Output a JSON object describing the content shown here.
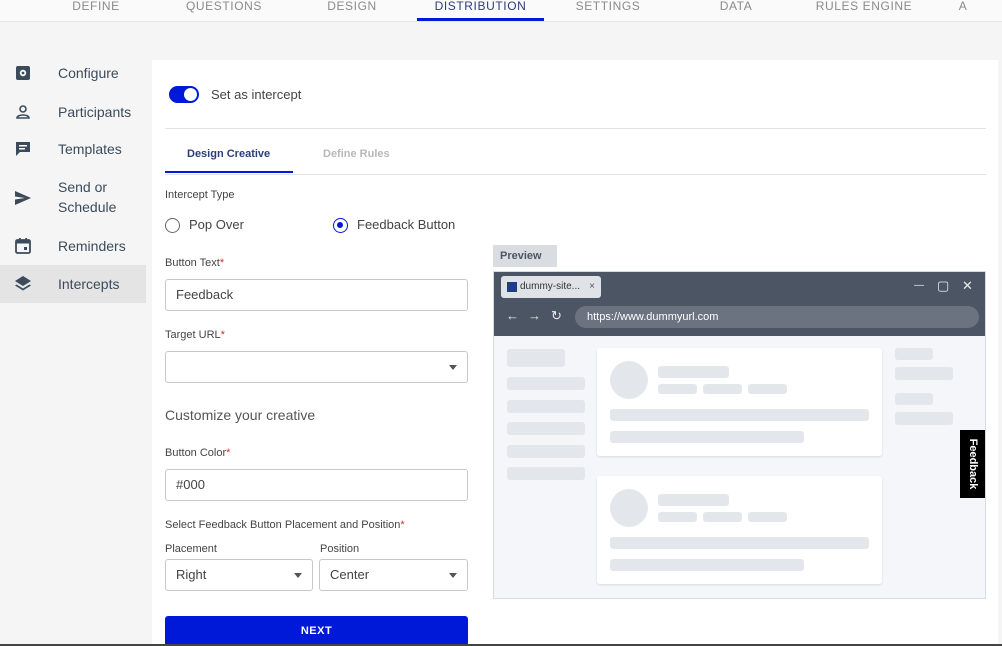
{
  "top_tabs": [
    {
      "label": "DEFINE"
    },
    {
      "label": "QUESTIONS"
    },
    {
      "label": "DESIGN"
    },
    {
      "label": "DISTRIBUTION"
    },
    {
      "label": "SETTINGS"
    },
    {
      "label": "DATA"
    },
    {
      "label": "RULES ENGINE"
    },
    {
      "label": "A"
    }
  ],
  "sidebar": {
    "items": [
      {
        "label": "Configure",
        "icon": "gear-icon"
      },
      {
        "label": "Participants",
        "icon": "person-icon"
      },
      {
        "label": "Templates",
        "icon": "chat-icon"
      },
      {
        "label": "Send or Schedule",
        "icon": "send-icon"
      },
      {
        "label": "Reminders",
        "icon": "calendar-icon"
      },
      {
        "label": "Intercepts",
        "icon": "layers-icon"
      }
    ]
  },
  "intercept": {
    "toggle_label": "Set as intercept",
    "sub_tabs": [
      {
        "label": "Design Creative"
      },
      {
        "label": "Define Rules"
      }
    ],
    "intercept_type_label": "Intercept Type",
    "options": [
      {
        "label": "Pop Over"
      },
      {
        "label": "Feedback Button"
      }
    ],
    "button_text_label": "Button Text",
    "button_text_value": "Feedback",
    "target_url_label": "Target URL",
    "target_url_value": "",
    "customize_title": "Customize your creative",
    "button_color_label": "Button Color",
    "button_color_value": "#000",
    "placement_section_label": "Select Feedback Button Placement and Position",
    "placement_label": "Placement",
    "placement_value": "Right",
    "position_label": "Position",
    "position_value": "Center",
    "required_mark": "*",
    "next_label": "NEXT"
  },
  "preview": {
    "tag": "Preview",
    "tab_title": "dummy-site...",
    "tab_close": "×",
    "url": "https://www.dummyurl.com",
    "minimize": "—",
    "maximize": "▢",
    "close": "✕",
    "back": "←",
    "forward": "→",
    "reload": "↻",
    "feedback_button_label": "Feedback"
  },
  "colors": {
    "accent": "#0018d8",
    "required": "#d32f2f",
    "browser_chrome": "#4b5563"
  }
}
